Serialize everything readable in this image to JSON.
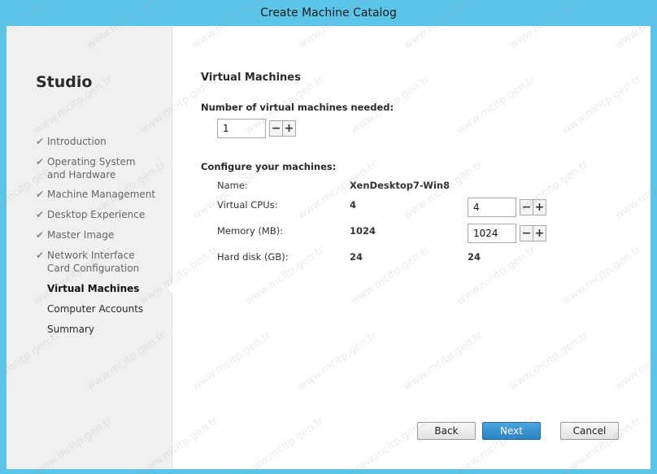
{
  "window": {
    "title": "Create Machine Catalog"
  },
  "sidebar": {
    "app_name": "Studio",
    "steps": [
      {
        "label": "Introduction",
        "status": "completed"
      },
      {
        "label": "Operating System and Hardware",
        "status": "completed"
      },
      {
        "label": "Machine Management",
        "status": "completed"
      },
      {
        "label": "Desktop Experience",
        "status": "completed"
      },
      {
        "label": "Master Image",
        "status": "completed"
      },
      {
        "label": "Network Interface Card Configuration",
        "status": "completed"
      },
      {
        "label": "Virtual Machines",
        "status": "active"
      },
      {
        "label": "Computer Accounts",
        "status": "pending"
      },
      {
        "label": "Summary",
        "status": "pending"
      }
    ]
  },
  "main": {
    "heading": "Virtual Machines",
    "vm_count": {
      "label": "Number of virtual machines needed:",
      "value": "1"
    },
    "configure": {
      "label": "Configure your machines:",
      "name_label": "Name:",
      "name_value": "XenDesktop7-Win8",
      "rows": [
        {
          "label": "Virtual CPUs:",
          "current": "4",
          "new_value": "4"
        },
        {
          "label": "Memory (MB):",
          "current": "1024",
          "new_value": "1024"
        },
        {
          "label": "Hard disk (GB):",
          "current": "24",
          "new_value": "24"
        }
      ]
    }
  },
  "buttons": {
    "back": "Back",
    "next": "Next",
    "cancel": "Cancel"
  },
  "icons": {
    "check": "✔",
    "minus": "−",
    "plus": "+"
  },
  "watermark_text": "www.mcitp.gen.tr",
  "colors": {
    "frame": "#5bc4e8",
    "primary_button": "#2b82c3",
    "sidebar": "#f0f0f0"
  }
}
